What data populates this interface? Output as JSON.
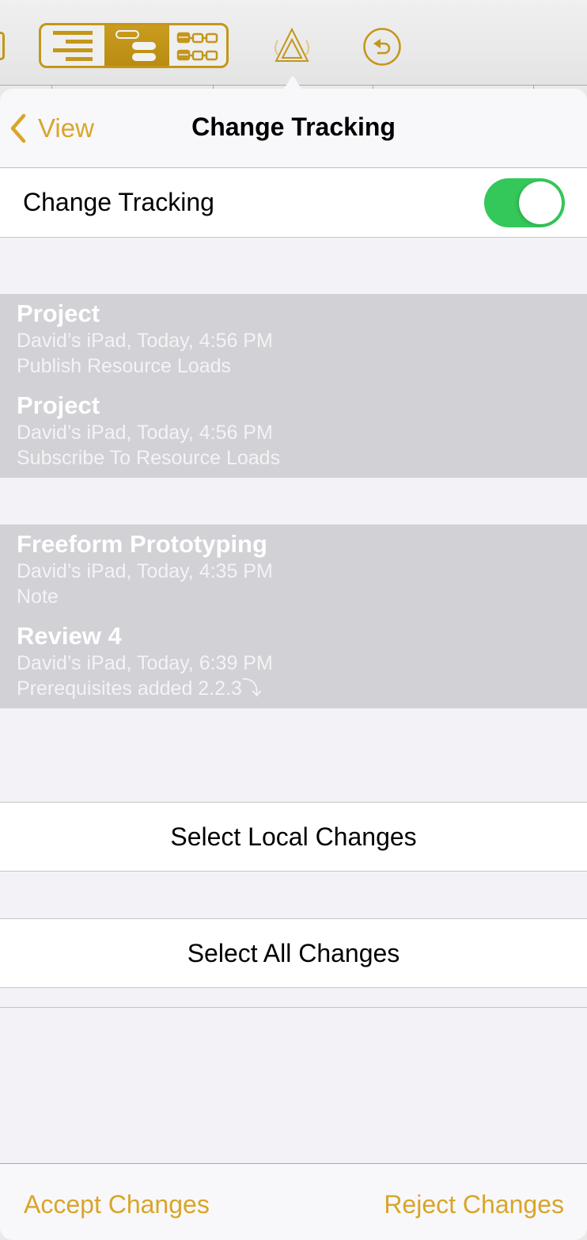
{
  "toolbar": {
    "view_modes": [
      {
        "name": "outline-view",
        "icon": "outline-icon",
        "selected": false
      },
      {
        "name": "hierarchy-view",
        "icon": "hierarchy-icon",
        "selected": true
      },
      {
        "name": "network-view",
        "icon": "network-icon",
        "selected": false
      }
    ],
    "change_tracking_icon": "change-tracking-icon",
    "undo_icon": "undo-icon",
    "accent_color": "#c4961a"
  },
  "popover": {
    "nav": {
      "back_label": "View",
      "title": "Change Tracking"
    },
    "toggle": {
      "label": "Change Tracking",
      "on": true,
      "on_color": "#34c759"
    },
    "change_groups": [
      {
        "items": [
          {
            "title": "Project",
            "meta": "David’s iPad, Today, 4:56 PM",
            "description": "Publish Resource Loads"
          },
          {
            "title": "Project",
            "meta": "David’s iPad, Today, 4:56 PM",
            "description": "Subscribe To Resource Loads"
          }
        ]
      },
      {
        "items": [
          {
            "title": "Freeform Prototyping",
            "meta": "David’s iPad, Today, 4:35 PM",
            "description": "Note"
          },
          {
            "title": "Review 4",
            "meta": "David’s iPad, Today, 6:39 PM",
            "description": "Prerequisites added 2.2.3⤵"
          }
        ]
      }
    ],
    "actions": {
      "select_local": "Select Local Changes",
      "select_all": "Select All Changes"
    },
    "bottom": {
      "accept": "Accept Changes",
      "reject": "Reject Changes",
      "accent_color": "#d9a52a"
    }
  }
}
